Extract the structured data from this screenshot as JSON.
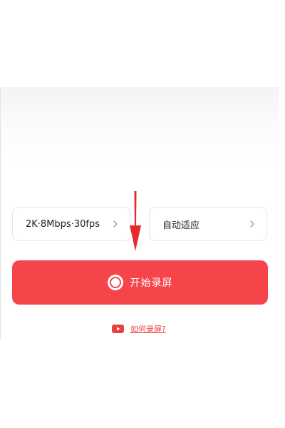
{
  "controls": {
    "quality_label": "2K·8Mbps·30fps",
    "orientation_label": "自动适应"
  },
  "record_button": {
    "label": "开始录屏"
  },
  "help": {
    "link_text": "如何录屏?"
  },
  "colors": {
    "accent": "#f6454a",
    "link": "#e8423f",
    "annotation_arrow": "#e6292b"
  },
  "icons": {
    "record": "record-circle-icon",
    "help": "video-play-icon",
    "chevron": "chevron-right-icon",
    "annotation": "arrow-down-icon"
  }
}
